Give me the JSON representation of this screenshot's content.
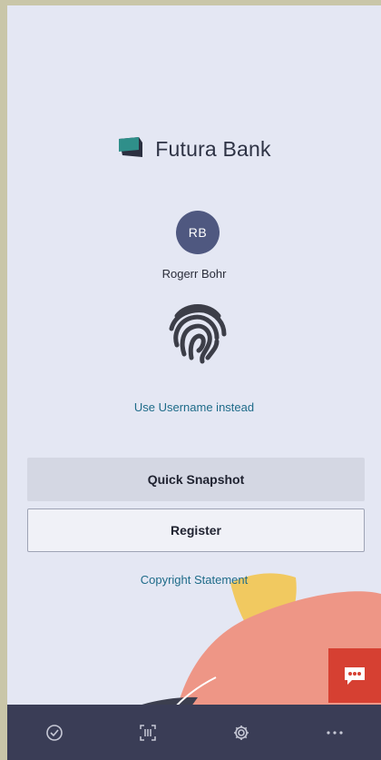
{
  "brand": {
    "name": "Futura Bank",
    "logo_icon": "futura-bank-logo-icon"
  },
  "user": {
    "initials": "RB",
    "name": "Rogerr Bohr"
  },
  "login": {
    "method_icon": "fingerprint-icon",
    "alt_link": "Use Username instead"
  },
  "actions": {
    "quick_snapshot": "Quick Snapshot",
    "register": "Register",
    "copyright": "Copyright Statement"
  },
  "chat": {
    "icon": "chat-bubble-icon"
  },
  "tabbar": {
    "items": [
      {
        "icon": "check-circle-icon"
      },
      {
        "icon": "barcode-scan-icon"
      },
      {
        "icon": "gear-icon"
      },
      {
        "icon": "more-dots-icon"
      }
    ]
  },
  "colors": {
    "background": "#e4e7f3",
    "accent_link": "#1e6b89",
    "avatar": "#4f5880",
    "tabbar": "#3a3d56",
    "chat": "#d64032",
    "logo": "#2f8f8a"
  }
}
